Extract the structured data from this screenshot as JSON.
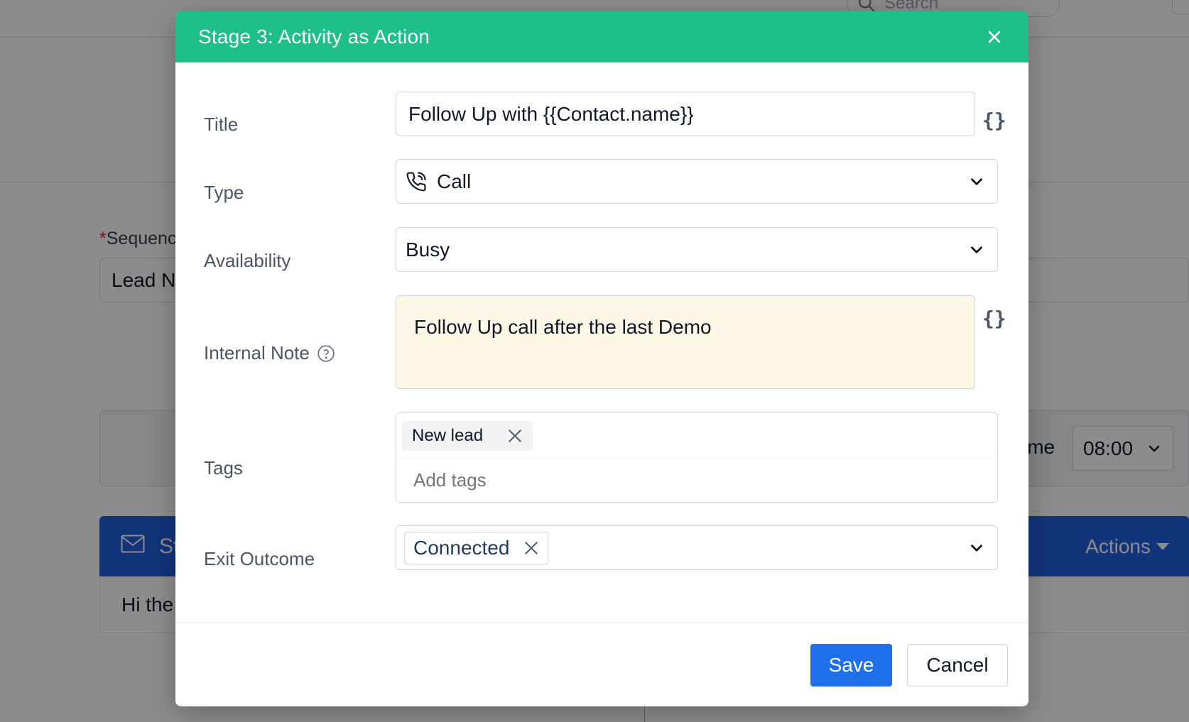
{
  "background": {
    "search_placeholder": "Search",
    "sequence_label": "Sequenc",
    "sequence_required_mark": "*",
    "sequence_value": "Lead N",
    "time_label": "ime",
    "time_value": "08:00",
    "step_title_fragment": "St",
    "actions_label": "Actions",
    "body_preview": "Hi the"
  },
  "modal": {
    "title": "Stage 3: Activity as Action",
    "fields": {
      "title": {
        "label": "Title",
        "value": "Follow Up with {{Contact.name}}",
        "var_icon": "{}"
      },
      "type": {
        "label": "Type",
        "value": "Call",
        "icon": "phone-call-icon"
      },
      "availability": {
        "label": "Availability",
        "value": "Busy"
      },
      "internal_note": {
        "label": "Internal Note",
        "value": "Follow Up call after the last Demo",
        "var_icon": "{}"
      },
      "tags": {
        "label": "Tags",
        "chips": [
          "New lead"
        ],
        "placeholder": "Add tags"
      },
      "exit_outcome": {
        "label": "Exit Outcome",
        "chips": [
          "Connected"
        ]
      }
    },
    "buttons": {
      "save": "Save",
      "cancel": "Cancel"
    }
  },
  "colors": {
    "header": "#1fbf88",
    "primary_button": "#1f6feb",
    "note_background": "#fef8e7",
    "background_bar": "#1f5fe0"
  }
}
